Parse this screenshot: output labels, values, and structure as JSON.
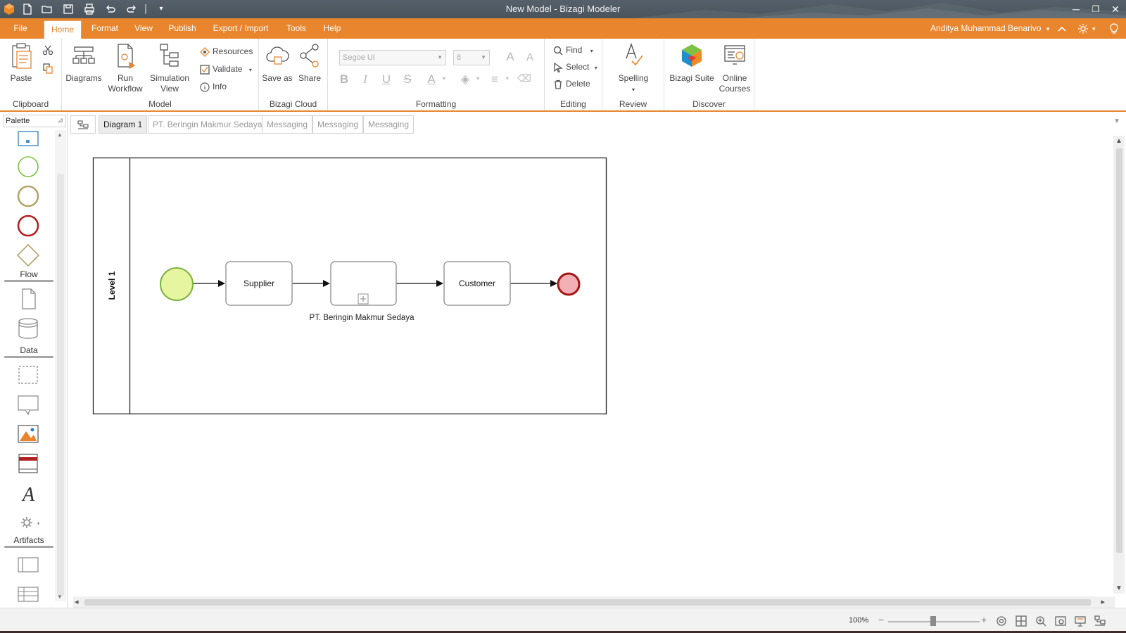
{
  "window": {
    "title": "New Model - Bizagi Modeler"
  },
  "menubar": {
    "items": [
      "File",
      "Home",
      "Format",
      "View",
      "Publish",
      "Export / Import",
      "Tools",
      "Help"
    ],
    "active": "Home",
    "user": "Anditya Muhammad Benarivo"
  },
  "ribbon": {
    "clipboard": {
      "label": "Clipboard",
      "paste": "Paste"
    },
    "model": {
      "label": "Model",
      "diagrams": "Diagrams",
      "run_workflow_1": "Run",
      "run_workflow_2": "Workflow",
      "simulation_1": "Simulation",
      "simulation_2": "View",
      "resources": "Resources",
      "validate": "Validate",
      "info": "Info"
    },
    "bizagi_cloud": {
      "label": "Bizagi Cloud",
      "save_as": "Save as",
      "share": "Share"
    },
    "formatting": {
      "label": "Formatting",
      "font": "Segoe UI",
      "size": "8"
    },
    "editing": {
      "label": "Editing",
      "find": "Find",
      "select": "Select",
      "delete": "Delete"
    },
    "review": {
      "label": "Review",
      "spelling": "Spelling"
    },
    "discover": {
      "label": "Discover",
      "suite": "Bizagi Suite",
      "courses_1": "Online",
      "courses_2": "Courses"
    }
  },
  "palette": {
    "title": "Palette",
    "sections": [
      "Flow",
      "Data",
      "Artifacts"
    ]
  },
  "tabs": [
    "Diagram 1",
    "PT. Beringin Makmur Sedaya",
    "Messaging",
    "Messaging",
    "Messaging"
  ],
  "active_tab": "Diagram 1",
  "diagram": {
    "lane_label": "Level 1",
    "tasks": [
      "Supplier",
      "Customer"
    ],
    "subprocess_label": "PT. Beringin Makmur Sedaya"
  },
  "statusbar": {
    "zoom": "100%"
  },
  "colors": {
    "accent": "#e8852d",
    "titlebar": "#4e5861",
    "start_event": "#e5f5a0",
    "end_event": "#f2b0b5"
  }
}
